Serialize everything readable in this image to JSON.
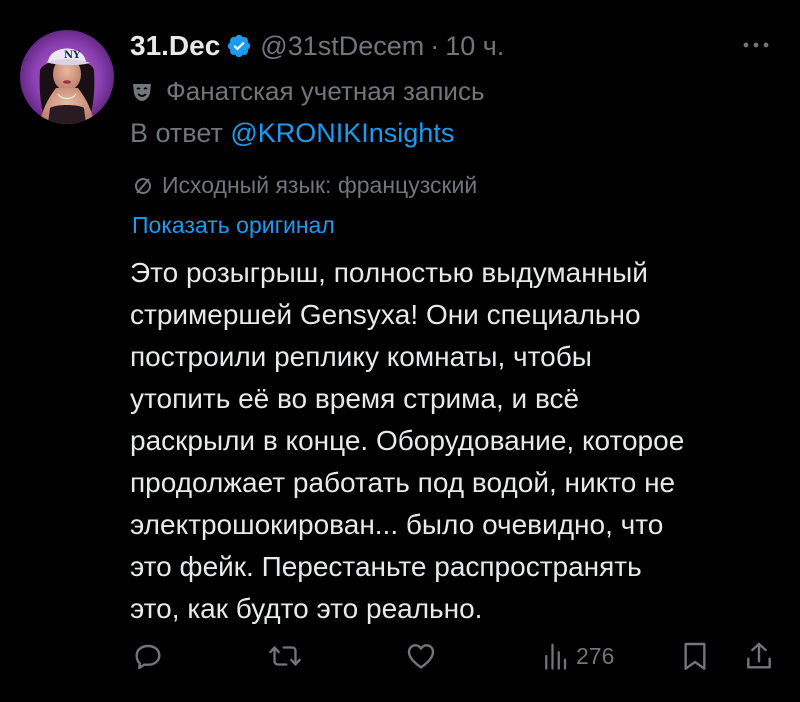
{
  "tweet": {
    "author": {
      "display_name": "31.Dec",
      "handle": "@31stDecem",
      "verified": true,
      "avatar_icon": "avatar-ny-cap-photo"
    },
    "separator": "·",
    "time": "10 ч.",
    "more_icon": "more-dots-icon",
    "fan_account_label": "Фанатская учетная запись",
    "fan_account_icon": "theater-mask-icon",
    "reply_to_prefix": "В ответ",
    "reply_to_handle": "@KRONIKInsights",
    "source_language_label": "Исходный язык: французский",
    "translate_icon": "translate-icon",
    "show_original": "Показать оригинал",
    "text_lines": [
      "Это розыгрыш, полностью выдуманный",
      "стримершей Gensyxa! Они специально",
      "построили реплику комнаты, чтобы",
      "утопить её во время стрима, и всё",
      "раскрыли в конце. Оборудование, которое",
      "продолжает работать под водой, никто не",
      "электрошокирован... было очевидно, что",
      "это фейк. Перестаньте распространять",
      "это, как будто это реально."
    ],
    "actions": {
      "reply_icon": "reply-icon",
      "retweet_icon": "retweet-icon",
      "like_icon": "like-icon",
      "views_icon": "views-chart-icon",
      "views_count": "276",
      "bookmark_icon": "bookmark-icon",
      "share_icon": "share-icon"
    }
  },
  "colors": {
    "background": "#000000",
    "primary_text": "#e7e9ea",
    "secondary_text": "#71767b",
    "accent": "#1d9bf0"
  }
}
